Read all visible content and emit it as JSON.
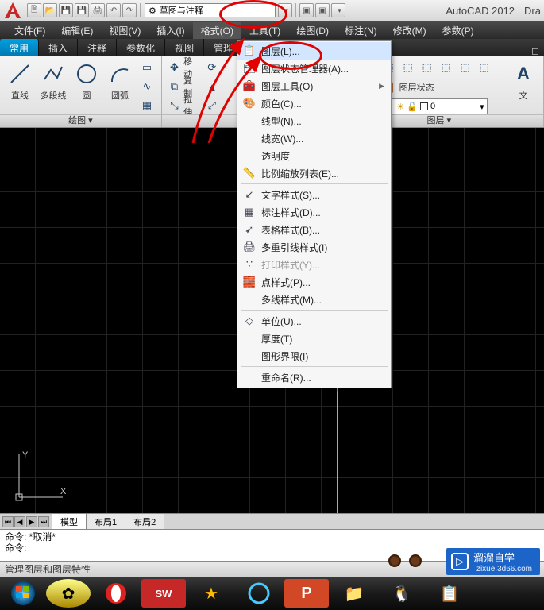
{
  "app": {
    "name": "AutoCAD 2012",
    "doc": "Dra"
  },
  "qat": {
    "search_combo": "草图与注释"
  },
  "menubar": [
    {
      "label": "文件(F)"
    },
    {
      "label": "编辑(E)"
    },
    {
      "label": "视图(V)"
    },
    {
      "label": "插入(I)"
    },
    {
      "label": "格式(O)",
      "active": true
    },
    {
      "label": "工具(T)"
    },
    {
      "label": "绘图(D)"
    },
    {
      "label": "标注(N)"
    },
    {
      "label": "修改(M)"
    },
    {
      "label": "参数(P)"
    }
  ],
  "tabs": [
    {
      "label": "常用",
      "active": true
    },
    {
      "label": "插入"
    },
    {
      "label": "注释"
    },
    {
      "label": "参数化"
    },
    {
      "label": "视图"
    },
    {
      "label": "管理"
    }
  ],
  "ribbon": {
    "draw_panel": "绘图",
    "draw_tools": [
      {
        "label": "直线"
      },
      {
        "label": "多段线"
      },
      {
        "label": "圆"
      },
      {
        "label": "圆弧"
      }
    ],
    "modify_tools": [
      {
        "label": "移动"
      },
      {
        "label": "复制"
      },
      {
        "label": "拉伸"
      }
    ],
    "layer_panel": "图层",
    "layer_state_btn": "图层状态",
    "layer_current": "0",
    "misc_panel_right": "文"
  },
  "format_menu": [
    {
      "label": "图层(L)...",
      "highlight": true
    },
    {
      "label": "图层状态管理器(A)..."
    },
    {
      "label": "图层工具(O)",
      "submenu": true
    },
    {
      "label": "颜色(C)..."
    },
    {
      "label": "线型(N)..."
    },
    {
      "label": "线宽(W)..."
    },
    {
      "label": "透明度"
    },
    {
      "label": "比例缩放列表(E)..."
    },
    {
      "sep": true
    },
    {
      "label": "文字样式(S)..."
    },
    {
      "label": "标注样式(D)..."
    },
    {
      "label": "表格样式(B)..."
    },
    {
      "label": "多重引线样式(I)"
    },
    {
      "label": "打印样式(Y)...",
      "disabled": true
    },
    {
      "label": "点样式(P)..."
    },
    {
      "label": "多线样式(M)..."
    },
    {
      "sep": true
    },
    {
      "label": "单位(U)..."
    },
    {
      "label": "厚度(T)"
    },
    {
      "label": "图形界限(I)"
    },
    {
      "sep": true
    },
    {
      "label": "重命名(R)..."
    }
  ],
  "menu_icons": [
    "📋",
    "🗂",
    "🧰",
    "🎨",
    "",
    "",
    "",
    "📏",
    "A",
    "↙",
    "▦",
    "➹",
    "🖨",
    "∵",
    "🧱",
    "",
    "0.0",
    "◇",
    "",
    "",
    "abl"
  ],
  "sheet_tabs": {
    "model": "模型",
    "layout1": "布局1",
    "layout2": "布局2"
  },
  "ucs": {
    "x": "X",
    "y": "Y"
  },
  "command": {
    "line1": "命令: *取消*",
    "line2": "命令:"
  },
  "status": {
    "text": "管理图层和图层特性"
  },
  "watermark": {
    "brand": "溜溜自学",
    "url": "zixue.3d66.com"
  }
}
